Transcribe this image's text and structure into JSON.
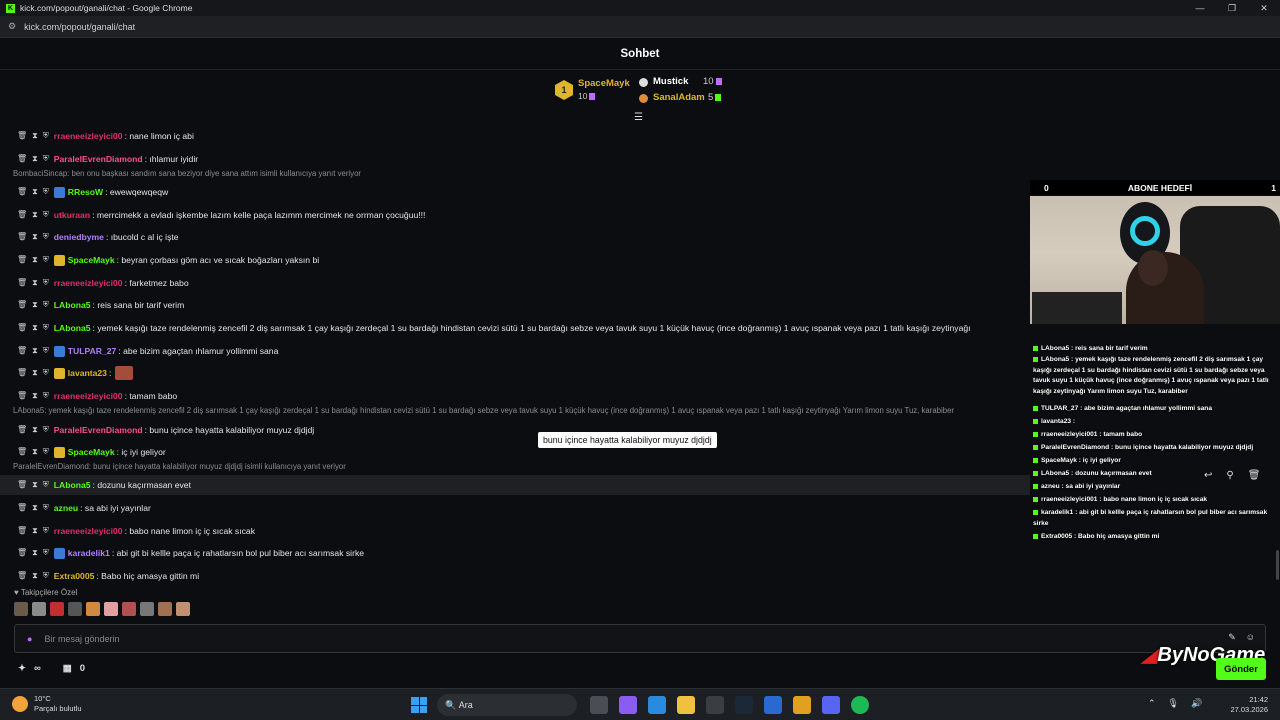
{
  "window": {
    "title": "kick.com/popout/ganali/chat - Google Chrome",
    "url": "kick.com/popout/ganali/chat",
    "brand_color": "#53fc18"
  },
  "header": {
    "title": "Sohbet"
  },
  "leaderboard": [
    {
      "rank": "1",
      "name": "SpaceMayk",
      "count": "10"
    },
    {
      "name": "Mustick",
      "count": "10"
    },
    {
      "name": "SanalAdam",
      "count": "5"
    }
  ],
  "messages": [
    {
      "user": "rraeneeizleyici00",
      "text": ": nane limon iç abi",
      "color": "#e0306a"
    },
    {
      "user": "ParalelEvrenDiamond",
      "text": ": ıhlamur iyidir",
      "color": "#ff4d8b"
    },
    {
      "reply": "BombaciSincap: ben onu başkası sandım sana beziyor diye sana attım isimli kullanıcıya yanıt veriyor"
    },
    {
      "user": "RResoW",
      "text": ": ewewqewqeqw",
      "color": "#53fc18"
    },
    {
      "user": "utkuraan",
      "text": ": merrcimekk a evladı işkembe lazım kelle paça lazımm mercimek ne orrman çocuğuu!!!",
      "color": "#e0306a"
    },
    {
      "user": "deniedbyme",
      "text": ": ıbucold c al iç işte",
      "color": "#b080ff"
    },
    {
      "user": "SpaceMayk",
      "text": ": beyran çorbası göm acı ve sıcak boğazları yaksın bi",
      "color": "#53fc18"
    },
    {
      "user": "rraeneeizleyici00",
      "text": ": farketmez babo",
      "color": "#e0306a"
    },
    {
      "user": "LAbona5",
      "text": ": reis sana bir tarif verim",
      "color": "#53fc18"
    },
    {
      "user": "LAbona5",
      "text": ": yemek kaşığı taze rendelenmiş zencefil 2 diş sarımsak 1 çay kaşığı zerdeçal 1 su bardağı hindistan cevizi sütü 1 su bardağı sebze veya tavuk suyu 1 küçük havuç (ince doğranmış) 1 avuç ıspanak veya pazı 1 tatlı kaşığı zeytinyağı",
      "color": "#53fc18"
    },
    {
      "user": "TULPAR_27",
      "text": ": abe bizim agaçtan ıhlamur yollimmi sana",
      "color": "#b080ff"
    },
    {
      "user": "lavanta23",
      "text": ":",
      "color": "#e0b52b"
    },
    {
      "user": "rraeneeizleyici00",
      "text": ": tamam babo",
      "color": "#e0306a"
    },
    {
      "reply": "LAbona5: yemek kaşığı taze rendelenmiş zencefil 2 diş sarımsak 1 çay kaşığı zerdeçal 1 su bardağı hindistan cevizi sütü 1 su bardağı sebze veya tavuk suyu 1 küçük havuç (ince doğranmış) 1 avuç ıspanak veya pazı 1 tatlı kaşığı zeytinyağı Yarım limon suyu Tuz, karabiber"
    },
    {
      "user": "ParalelEvrenDiamond",
      "text": ": bunu içince hayatta kalabiliyor muyuz djdjdj",
      "color": "#ff4d8b"
    },
    {
      "user": "SpaceMayk",
      "text": ": iç iyi geliyor",
      "color": "#53fc18"
    },
    {
      "reply": "ParalelEvrenDiamond: bunu içince hayatta kalabiliyor muyuz djdjdj isimli kullanıcıya yanıt veriyor"
    },
    {
      "user": "LAbona5",
      "text": ": dozunu kaçırmasan evet",
      "color": "#53fc18"
    },
    {
      "user": "azneu",
      "text": ": sa abi iyi yayınlar",
      "color": "#53fc18"
    },
    {
      "user": "rraeneeizleyici00",
      "text": ": babo nane limon iç iç sıcak sıcak",
      "color": "#e0306a"
    },
    {
      "user": "karadelik1",
      "text": ": abi git bi kellle paça iç rahatlarsın bol pul biber acı sarımsak sirke",
      "color": "#b080ff"
    },
    {
      "user": "Extra0005",
      "text": ": Babo hiç amasya gittin mi",
      "color": "#e0b52b"
    }
  ],
  "tooltip": "bunu içince hayatta kalabiliyor muyuz djdjdj",
  "followers_label": "Takipçilere Özel",
  "input": {
    "placeholder": "Bir mesaj gönderin",
    "send_label": "Gönder"
  },
  "bottom": {
    "count": "0"
  },
  "overlay": {
    "goal_left": "0",
    "goal_title": "ABONE HEDEFİ",
    "goal_right": "1",
    "lines": [
      "LAbona5 : reis sana bir tarif verim",
      "LAbona5 : yemek kaşığı taze rendelenmiş zencefil 2 diş sarımsak 1 çay kaşığı zerdeçal 1 su bardağı hindistan cevizi sütü 1 su bardağı sebze veya tavuk suyu 1 küçük havuç (ince doğranmış) 1 avuç ıspanak veya pazı 1 tatlı kaşığı zeytinyağı Yarım limon suyu Tuz, karabiber",
      "TULPAR_27 : abe bizim agaçtan ıhlamur yollimmi sana",
      "lavanta23 :",
      "rraeneeizleyici001 : tamam babo",
      "ParalelEvrenDiamond : bunu içince hayatta kalabiliyor muyuz djdjdj",
      "SpaceMayk : iç iyi geliyor",
      "LAbona5 : dozunu kaçırmasan evet",
      "azneu : sa abi iyi yayınlar",
      "rraeneeizleyici001 : babo nane limon iç iç sıcak sıcak",
      "karadelik1 : abi git bi kellle paça iç rahatlarsın bol pul biber acı sarımsak sirke",
      "Extra0005 : Babo hiç amasya gittin mi"
    ],
    "brand": "ByNoGame"
  },
  "taskbar": {
    "temp": "10°C",
    "weather": "Parçalı bulutlu",
    "search": "Ara",
    "time": "21:42",
    "date": "27.03.2026"
  }
}
